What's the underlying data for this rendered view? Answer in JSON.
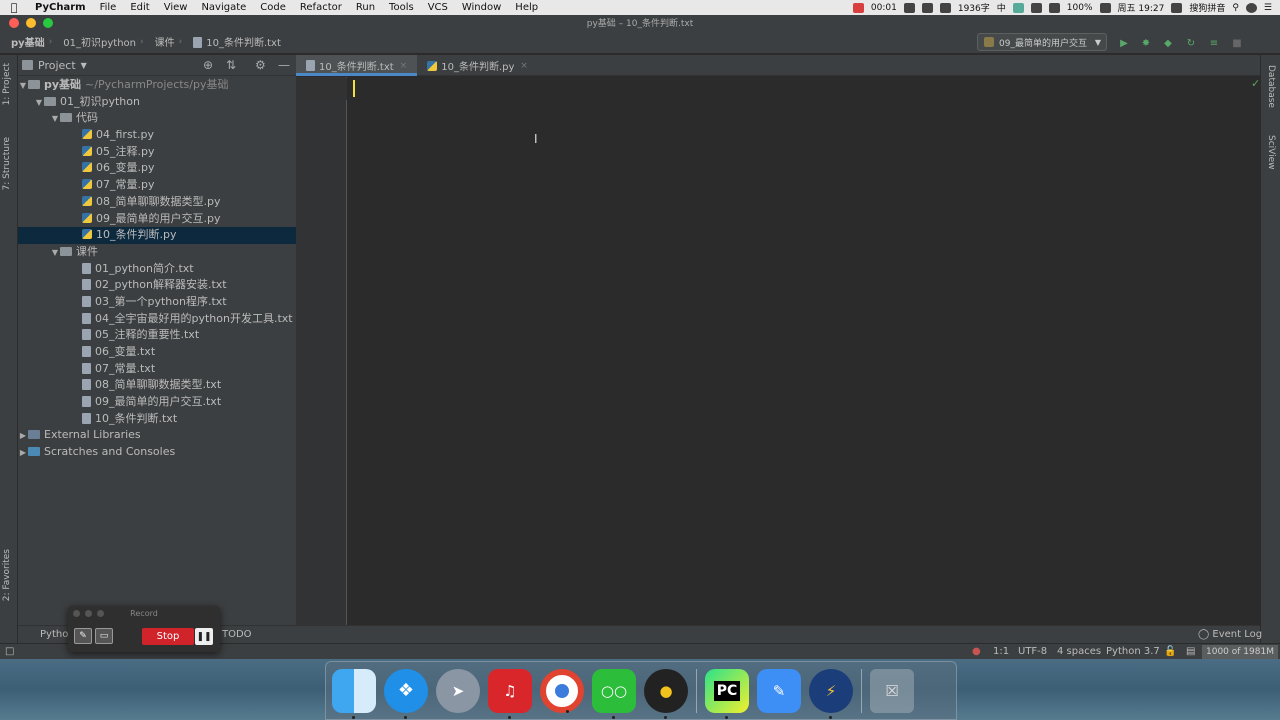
{
  "menubar": {
    "app_name": "PyCharm",
    "items": [
      "File",
      "Edit",
      "View",
      "Navigate",
      "Code",
      "Refactor",
      "Run",
      "Tools",
      "VCS",
      "Window",
      "Help"
    ],
    "status": {
      "timer": "00:01",
      "word_count": "1936字",
      "input_lang": "中",
      "battery": "100%",
      "clock": "周五 19:27",
      "ime": "搜狗拼音"
    }
  },
  "window": {
    "title": "py基础 – 10_条件判断.txt"
  },
  "navbar": {
    "breadcrumbs": [
      "py基础",
      "01_初识python",
      "课件",
      "10_条件判断.txt"
    ],
    "run_config": "09_最简单的用户交互"
  },
  "left_strip": {
    "project_tab": "1: Project",
    "structure_tab": "7: Structure",
    "favorites_tab": "2: Favorites"
  },
  "right_strip": {
    "database_tab": "Database",
    "sciview_tab": "SciView"
  },
  "project": {
    "header": "Project",
    "root": {
      "name": "py基础",
      "path": "~/PycharmProjects/py基础"
    },
    "folder_main": "01_初识python",
    "folder_code": "代码",
    "code_files": [
      "04_first.py",
      "05_注释.py",
      "06_变量.py",
      "07_常量.py",
      "08_简单聊聊数据类型.py",
      "09_最简单的用户交互.py",
      "10_条件判断.py"
    ],
    "folder_course": "课件",
    "course_files": [
      "01_python简介.txt",
      "02_python解释器安装.txt",
      "03_第一个python程序.txt",
      "04_全宇宙最好用的python开发工具.txt",
      "05_注释的重要性.txt",
      "06_变量.txt",
      "07_常量.txt",
      "08_简单聊聊数据类型.txt",
      "09_最简单的用户交互.txt",
      "10_条件判断.txt"
    ],
    "external_libraries": "External Libraries",
    "scratches": "Scratches and Consoles"
  },
  "editor": {
    "tabs": [
      {
        "label": "10_条件判断.txt",
        "active": true
      },
      {
        "label": "10_条件判断.py",
        "active": false
      }
    ]
  },
  "bottom_toolbar": {
    "python_tab": "Pytho",
    "todo_tab": "TODO",
    "event_log": "Event Log"
  },
  "statusbar": {
    "position": "1:1",
    "encoding": "UTF-8",
    "indent": "4 spaces",
    "interpreter": "Python 3.7",
    "memory": "1000 of 1981M"
  },
  "record_widget": {
    "title": "Record",
    "stop_label": "Stop"
  },
  "dock": {
    "apps": [
      "finder-icon",
      "safari-icon",
      "launchpad-icon",
      "netease-music-icon",
      "chrome-icon",
      "wechat-icon",
      "qq-icon",
      "pycharm-icon",
      "feishu-icon",
      "sparkle-icon",
      "trash-icon"
    ],
    "pycharm_label": "PC"
  },
  "colors": {
    "accent": "#4a88c7",
    "selection": "#0d293e",
    "caret": "#f2e03c",
    "stop": "#d0232a"
  }
}
